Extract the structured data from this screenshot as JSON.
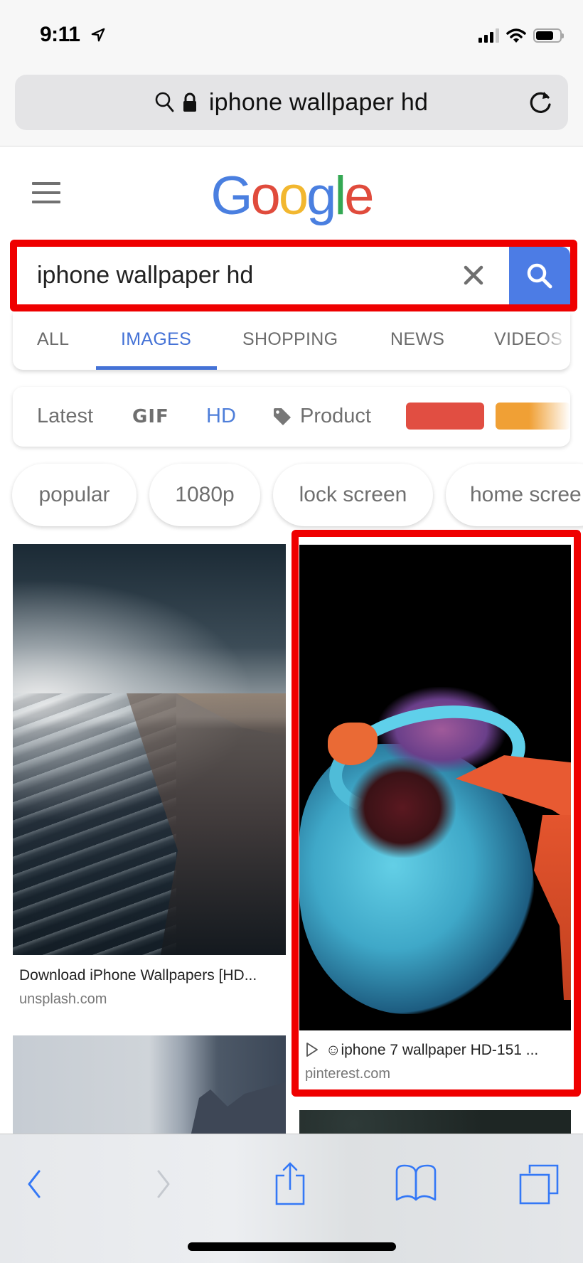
{
  "status_bar": {
    "time": "9:11",
    "location_icon": "location-arrow-icon",
    "signal_icon": "cellular-signal-icon",
    "wifi_icon": "wifi-icon",
    "battery_icon": "battery-icon",
    "battery_level": 0.74
  },
  "safari": {
    "url_text": "iphone wallpaper hd",
    "search_icon": "search-icon",
    "lock_icon": "lock-icon",
    "reload_icon": "reload-icon"
  },
  "google": {
    "menu_icon": "hamburger-menu-icon",
    "logo": [
      {
        "ch": "G",
        "color": "#4a7fe0"
      },
      {
        "ch": "o",
        "color": "#e04b3c"
      },
      {
        "ch": "o",
        "color": "#f2b72f"
      },
      {
        "ch": "g",
        "color": "#4a7fe0"
      },
      {
        "ch": "l",
        "color": "#34a853"
      },
      {
        "ch": "e",
        "color": "#e04b3c"
      }
    ],
    "search": {
      "value": "iphone wallpaper hd",
      "clear_icon": "close-icon",
      "submit_icon": "search-icon"
    },
    "tabs": [
      {
        "label": "ALL",
        "active": false
      },
      {
        "label": "IMAGES",
        "active": true
      },
      {
        "label": "SHOPPING",
        "active": false
      },
      {
        "label": "NEWS",
        "active": false
      },
      {
        "label": "VIDEOS",
        "active": false
      }
    ],
    "filters": {
      "latest": "Latest",
      "gif": "GIF",
      "hd": "HD",
      "product": "Product",
      "product_icon": "tag-icon",
      "color_swatches": [
        "#e14e42",
        "#f0a035"
      ]
    },
    "chips": [
      "popular",
      "1080p",
      "lock screen",
      "home scree"
    ],
    "results": [
      {
        "title": "Download iPhone Wallpapers [HD...",
        "domain": "unsplash.com",
        "image": "beach-shoreline-photo"
      },
      {
        "title": "☺iphone 7 wallpaper HD-151 ...",
        "domain": "pinterest.com",
        "image": "paint-splash-photo",
        "prefix_icon": "play-icon",
        "highlighted": true
      },
      {
        "image": "misty-mountain-photo"
      },
      {
        "image": "dark-texture-photo"
      }
    ]
  },
  "toolbar": {
    "back_icon": "chevron-left-icon",
    "forward_icon": "chevron-right-icon",
    "share_icon": "share-icon",
    "bookmarks_icon": "book-icon",
    "tabs_icon": "tabs-icon"
  },
  "colors": {
    "accent_blue": "#4472d6",
    "search_button": "#4c7ce5",
    "highlight_red": "#ef0000",
    "ios_blue": "#3478f6"
  }
}
